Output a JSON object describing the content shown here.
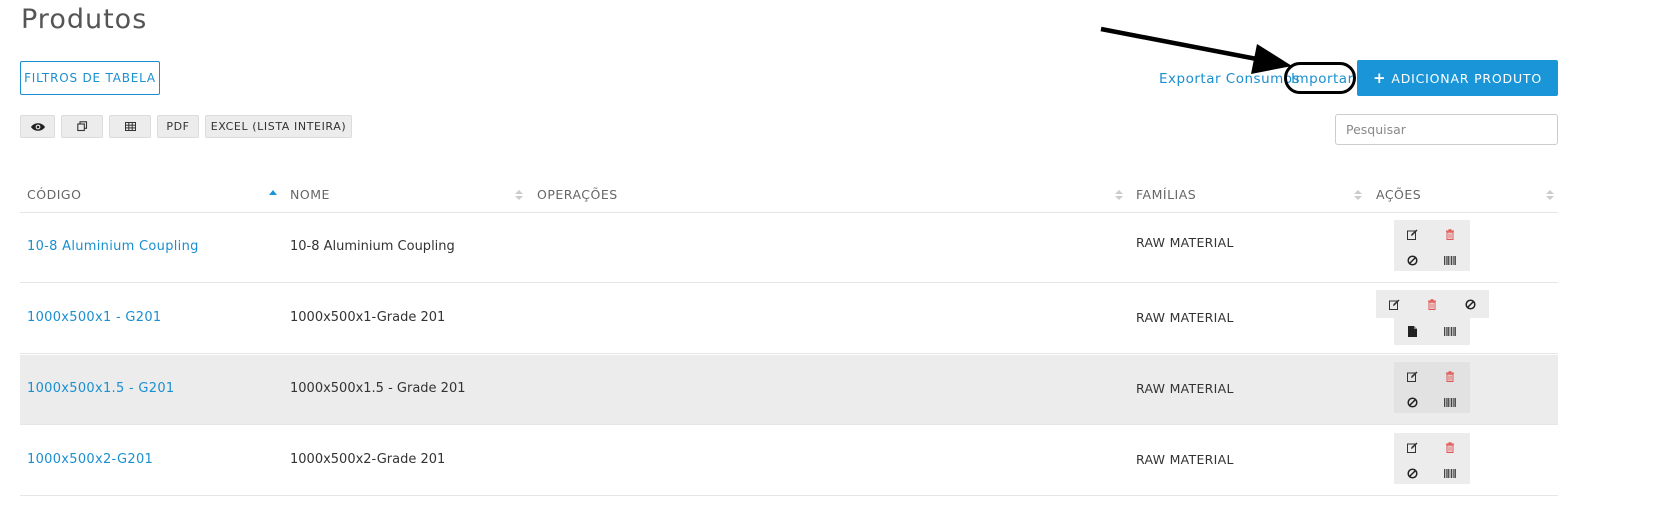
{
  "page": {
    "title": "Produtos"
  },
  "toolbar": {
    "filters_label": "FILTROS DE TABELA",
    "export_label": "Exportar Consumos",
    "import_label": "Importar",
    "add_label": "ADICIONAR PRODUTO",
    "add_icon": "plus-icon",
    "buttons": {
      "view_icon": "eye-icon",
      "copy_icon": "copy-icon",
      "csv_icon": "table-icon",
      "pdf_label": "PDF",
      "excel_label": "EXCEL (LISTA INTEIRA)"
    },
    "search_placeholder": "Pesquisar"
  },
  "table": {
    "columns": [
      "CÓDIGO",
      "NOME",
      "OPERAÇÕES",
      "FAMÍLIAS",
      "AÇÕES"
    ],
    "sorted_column": "CÓDIGO",
    "sort_direction": "asc",
    "rows": [
      {
        "code": "10-8 Aluminium Coupling",
        "name": "10-8 Aluminium Coupling",
        "operations": "",
        "family": "RAW MATERIAL",
        "actions": [
          "edit-icon",
          "delete-icon",
          "disable-icon",
          "barcode-icon"
        ]
      },
      {
        "code": "1000x500x1 - G201",
        "name": "1000x500x1-Grade 201",
        "operations": "",
        "family": "RAW MATERIAL",
        "actions": [
          "edit-icon",
          "delete-icon",
          "disable-icon",
          "file-icon",
          "barcode-icon"
        ]
      },
      {
        "code": "1000x500x1.5 - G201",
        "name": "1000x500x1.5 - Grade 201",
        "operations": "",
        "family": "RAW MATERIAL",
        "actions": [
          "edit-icon",
          "delete-icon",
          "disable-icon",
          "barcode-icon"
        ]
      },
      {
        "code": "1000x500x2-G201",
        "name": "1000x500x2-Grade 201",
        "operations": "",
        "family": "RAW MATERIAL",
        "actions": [
          "edit-icon",
          "delete-icon",
          "disable-icon",
          "barcode-icon"
        ]
      }
    ]
  },
  "colors": {
    "accent": "#1a96d8",
    "link": "#1a8fd1",
    "delete": "#e05555",
    "alt_row": "#ececec",
    "annotation": "#000000"
  },
  "annotation": {
    "type": "arrow-and-ellipse",
    "target": "import-link"
  }
}
